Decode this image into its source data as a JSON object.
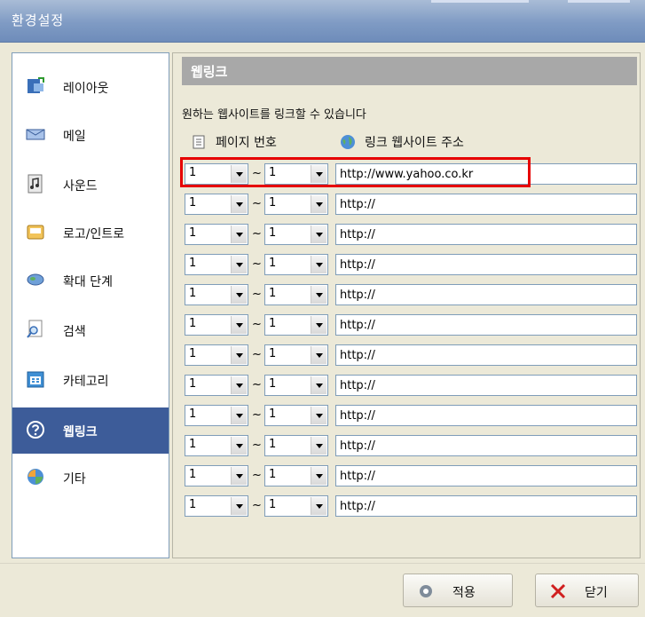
{
  "window": {
    "title": "환경설정"
  },
  "sidebar": {
    "items": [
      {
        "label": "레이아웃",
        "icon": "layout-icon",
        "selected": false
      },
      {
        "label": "메일",
        "icon": "mail-icon",
        "selected": false
      },
      {
        "label": "사운드",
        "icon": "sound-icon",
        "selected": false
      },
      {
        "label": "로고/인트로",
        "icon": "logo-intro-icon",
        "selected": false
      },
      {
        "label": "확대 단계",
        "icon": "zoom-level-icon",
        "selected": false
      },
      {
        "label": "검색",
        "icon": "search-icon",
        "selected": false
      },
      {
        "label": "카테고리",
        "icon": "category-icon",
        "selected": false
      },
      {
        "label": "웹링크",
        "icon": "help-circle-icon",
        "selected": true
      },
      {
        "label": "기타",
        "icon": "misc-icon",
        "selected": false
      }
    ]
  },
  "weblink": {
    "header": "웹링크",
    "description": "원하는 웹사이트를 링크할 수 있습니다",
    "col_page": "페이지 번호",
    "col_url": "링크 웹사이트 주소",
    "rows": [
      {
        "from": "1",
        "to": "1",
        "url": "http://www.yahoo.co.kr"
      },
      {
        "from": "1",
        "to": "1",
        "url": "http://"
      },
      {
        "from": "1",
        "to": "1",
        "url": "http://"
      },
      {
        "from": "1",
        "to": "1",
        "url": "http://"
      },
      {
        "from": "1",
        "to": "1",
        "url": "http://"
      },
      {
        "from": "1",
        "to": "1",
        "url": "http://"
      },
      {
        "from": "1",
        "to": "1",
        "url": "http://"
      },
      {
        "from": "1",
        "to": "1",
        "url": "http://"
      },
      {
        "from": "1",
        "to": "1",
        "url": "http://"
      },
      {
        "from": "1",
        "to": "1",
        "url": "http://"
      },
      {
        "from": "1",
        "to": "1",
        "url": "http://"
      },
      {
        "from": "1",
        "to": "1",
        "url": "http://"
      }
    ],
    "tilde": "~"
  },
  "buttons": {
    "apply": "적용",
    "close": "닫기"
  },
  "colors": {
    "selected_bg": "#3d5c99",
    "highlight": "#e60000",
    "titlebar": "#7f9bc4"
  }
}
